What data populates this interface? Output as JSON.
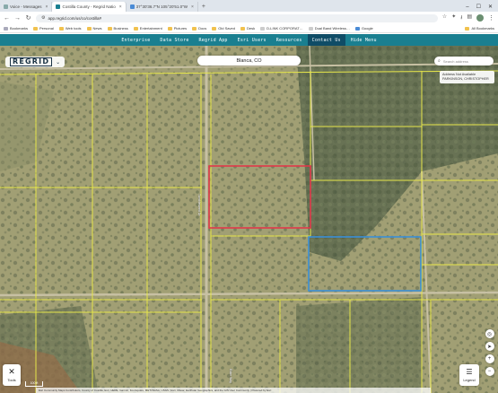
{
  "browser": {
    "tabs": [
      {
        "label": "Voice - Messages",
        "active": false
      },
      {
        "label": "Costilla County - Regrid Natio",
        "active": true
      },
      {
        "label": "37°30'36.7\"N 105°20'51.0\"W",
        "active": false
      }
    ],
    "new_tab": "+",
    "window_controls": [
      "–",
      "☐",
      "✕"
    ],
    "url": "app.regrid.com/us/co/costilla#",
    "bookmarks": [
      "Bookmarks",
      "Personal",
      "Web tools",
      "News",
      "Business",
      "Entertainment",
      "Pictures",
      "Docs",
      "Old Saved",
      "Desk",
      "D-LINK CORPORAT…",
      "Dual Band Wireless…",
      "Google"
    ],
    "all_bookmarks": "All Bookmarks"
  },
  "topnav": {
    "items": [
      "Enterprise",
      "Data Store",
      "Regrid App",
      "Esri Users",
      "Resources",
      "Contact Us",
      "Hide Menu"
    ],
    "active_index": 5
  },
  "map": {
    "logo": "REGRID",
    "place": "Blanca, CO",
    "search_placeholder": "Search address",
    "owner_line1": "Address Not Available",
    "owner_line2": "PARKINSON, CHRISTOPHER",
    "tools_label": "Tools",
    "legend_label": "Legend",
    "zoom_in": "+",
    "zoom_out": "−",
    "scale_label": "100 ft",
    "attribution": "Esri Community Maps Contributors, County of Costilla, Esri, HERE, Garmin, Foursquare, METI/NASA, USGS | Esri, Maxar, Earthstar Geographics, and the GIS User Community | Powered by Esri",
    "road_labels": [
      "Tumbleweed Dr",
      "Elder Way"
    ],
    "highlight_red_color": "#e0394a",
    "highlight_blue_color": "#3b8fd6",
    "parcel_line_color": "#e6e64a"
  }
}
